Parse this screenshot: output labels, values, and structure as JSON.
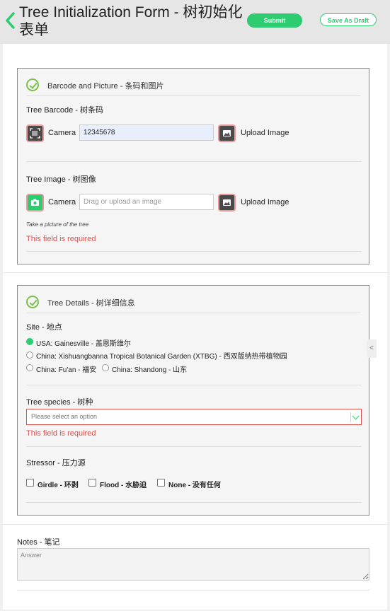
{
  "header": {
    "title": "Tree Initialization Form - 树初始化表单",
    "submit_label": "Submit",
    "draft_label": "Save As Draft"
  },
  "barcode_section": {
    "title": "Barcode and Picture - 条码和图片",
    "barcode_label": "Tree Barcode - 树条码",
    "camera_label": "Camera",
    "barcode_value": "12345678",
    "upload_label": "Upload Image",
    "image_label": "Tree Image - 树图像",
    "image_camera_label": "Camera",
    "image_placeholder": "Drag or upload an image",
    "image_upload_label": "Upload Image",
    "image_hint": "Take a picture of the tree",
    "image_error": "This field is required"
  },
  "tree_section": {
    "title": "Tree Details - 树详细信息",
    "site_label": "Site - 地点",
    "site_options": [
      {
        "label": "USA: Gainesville - 盖恩斯维尔",
        "selected": true
      },
      {
        "label": "China: Xishuangbanna Tropical Botanical Garden (XTBG) - 西双版纳热带植物园",
        "selected": false
      },
      {
        "label": "China: Fu'an - 福安",
        "selected": false
      },
      {
        "label": "China: Shandong - 山东",
        "selected": false
      }
    ],
    "species_label": "Tree species - 树种",
    "species_placeholder": "Please select an option",
    "species_error": "This field is required",
    "stressor_label": "Stressor - 压力源",
    "stressors": [
      {
        "label": "Girdle - 环剥",
        "checked": false
      },
      {
        "label": "Flood - 水胁迫",
        "checked": false
      },
      {
        "label": "None - 没有任何",
        "checked": false
      }
    ]
  },
  "notes": {
    "label": "Notes - 笔记",
    "placeholder": "Answer"
  },
  "side_tab_glyph": "<",
  "colors": {
    "accent": "#2ecc71",
    "error": "#d9534f",
    "check": "#7cc04b"
  }
}
